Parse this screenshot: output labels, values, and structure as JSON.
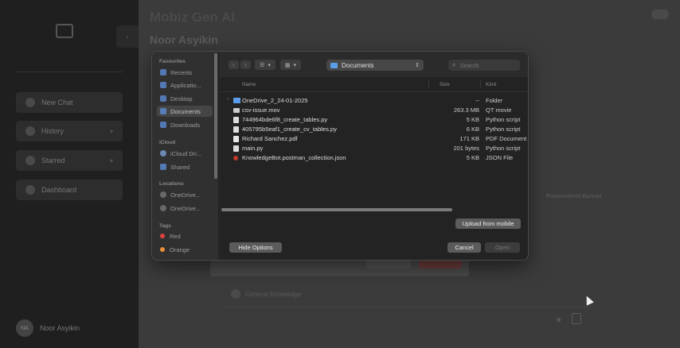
{
  "app": {
    "title": "Mobiz Gen AI",
    "subtitle": "Noor Asyikin",
    "sidebar_buttons": [
      {
        "label": "New Chat"
      },
      {
        "label": "History"
      },
      {
        "label": "Starred"
      },
      {
        "label": "Dashboard"
      }
    ],
    "user": {
      "initials": "NA",
      "name": "Noor Asyikin"
    },
    "side_text": {
      "line1": "",
      "line2": "Procurement Bureau"
    },
    "chat_label": "General Knowledge",
    "chat_time": ""
  },
  "dialog": {
    "sidebar": {
      "favourites_head": "Favourites",
      "favourites": [
        "Recents",
        "Applicatio...",
        "Desktop",
        "Documents",
        "Downloads"
      ],
      "icloud_head": "iCloud",
      "icloud": [
        "iCloud Dri...",
        "Shared"
      ],
      "locations_head": "Locations",
      "locations": [
        "OneDrive...",
        "OneDrive..."
      ],
      "tags_head": "Tags",
      "tags": [
        {
          "label": "Red",
          "color": "#e0443e"
        },
        {
          "label": "Orange",
          "color": "#e8913a"
        }
      ]
    },
    "toolbar": {
      "path": "Documents",
      "search_placeholder": "Search"
    },
    "columns": {
      "name": "Name",
      "size": "Size",
      "kind": "Kind"
    },
    "files": [
      {
        "name": "OneDrive_2_24-01-2025",
        "size": "--",
        "kind": "Folder",
        "type": "folder"
      },
      {
        "name": "csv-issue.mov",
        "size": "263.3 MB",
        "kind": "QT movie",
        "type": "mov"
      },
      {
        "name": "744964bde6f8_create_tables.py",
        "size": "5 KB",
        "kind": "Python script",
        "type": "doc"
      },
      {
        "name": "405795b5eaf1_create_cv_tables.py",
        "size": "6 KB",
        "kind": "Python script",
        "type": "doc"
      },
      {
        "name": "Richard Sanchez.pdf",
        "size": "171 KB",
        "kind": "PDF Document",
        "type": "pdf"
      },
      {
        "name": "main.py",
        "size": "201 bytes",
        "kind": "Python script",
        "type": "doc"
      },
      {
        "name": "KnowledgeBot.postman_collection.json",
        "size": "5 KB",
        "kind": "JSON File",
        "type": "json"
      }
    ],
    "buttons": {
      "upload": "Upload from mobile",
      "hide_options": "Hide Options",
      "cancel": "Cancel",
      "open": "Open"
    }
  }
}
